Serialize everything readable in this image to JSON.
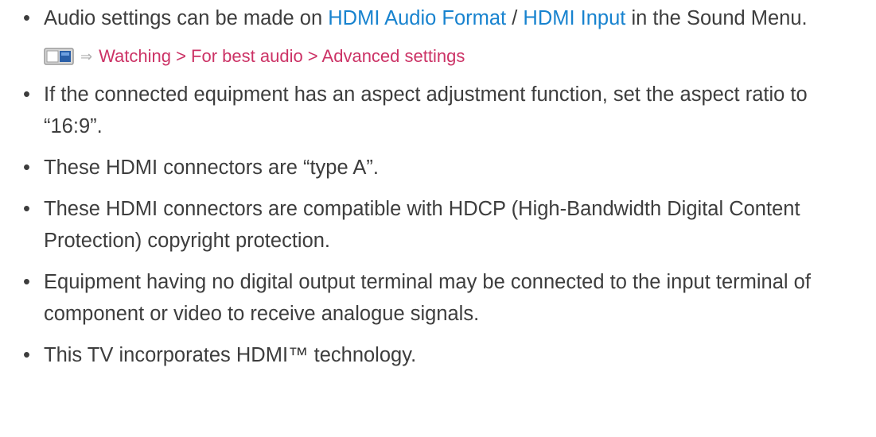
{
  "bullet_symbol": "•",
  "item1": {
    "before": "Audio settings can be made on ",
    "link1": "HDMI Audio Format",
    "separator": " / ",
    "link2": "HDMI Input",
    "after": " in the Sound Menu."
  },
  "reference": {
    "icon": "tv-menu-icon",
    "arrow": "⇒",
    "path": "Watching > For best audio > Advanced settings"
  },
  "item2": "If the connected equipment has an aspect adjustment function, set the aspect ratio to “16:9”.",
  "item3": "These HDMI connectors are “type A”.",
  "item4": "These HDMI connectors are compatible with HDCP (High-Bandwidth Digital Content Protection) copyright protection.",
  "item5": "Equipment having no digital output terminal may be connected to the input terminal of component or video to receive analogue signals.",
  "item6": "This TV incorporates HDMI™ technology.",
  "colors": {
    "text": "#3d3d3d",
    "link": "#1883cf",
    "reference": "#cc3366"
  }
}
